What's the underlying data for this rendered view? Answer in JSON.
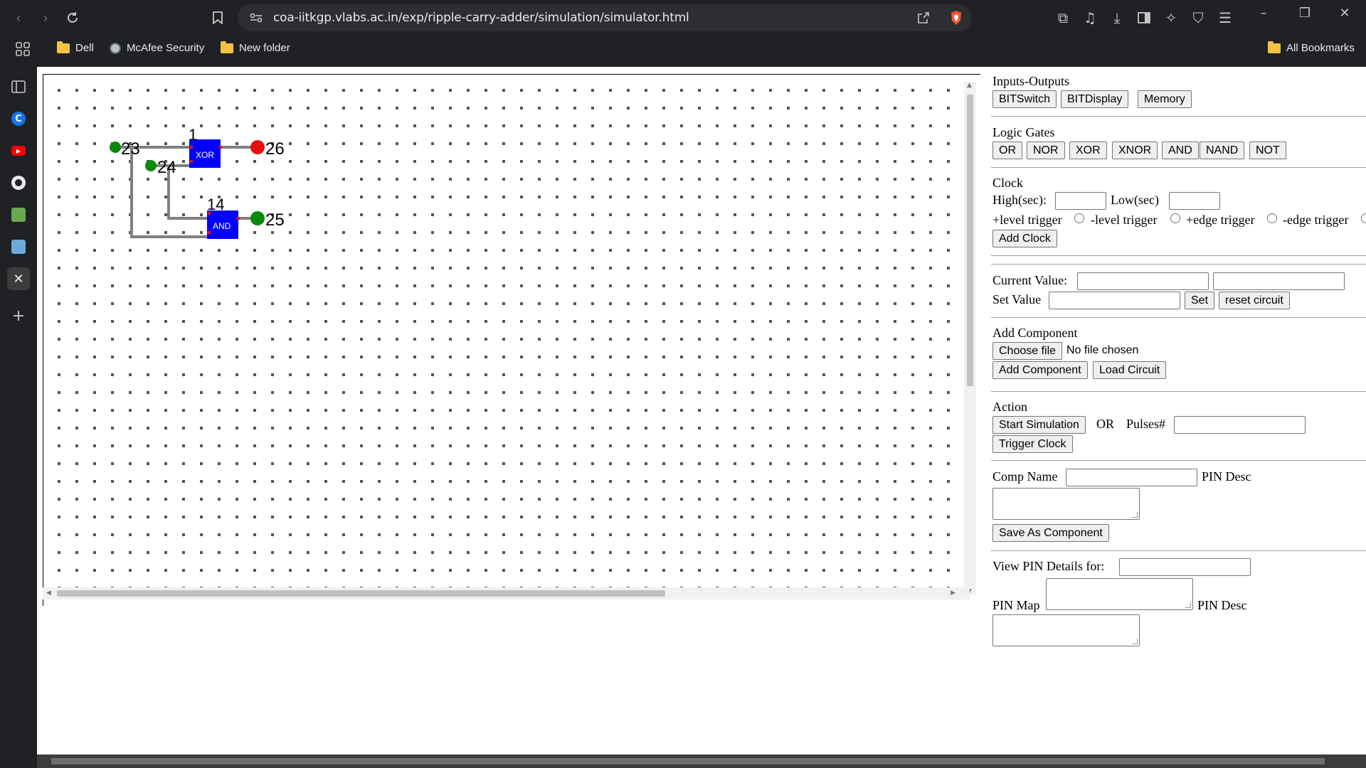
{
  "browser": {
    "url": "coa-iitkgp.vlabs.ac.in/exp/ripple-carry-adder/simulation/simulator.html",
    "bookmarks": [
      "Dell",
      "McAfee Security",
      "New folder"
    ],
    "all_bookmarks": "All Bookmarks",
    "sidebar_icons": [
      "sidebar-icon",
      "c-icon",
      "youtube-icon",
      "github-icon",
      "image-icon",
      "image-icon-2",
      "close-icon",
      "plus-icon"
    ]
  },
  "circuit": {
    "gates": [
      {
        "label": "XOR",
        "number": "1"
      },
      {
        "label": "AND",
        "number": "14"
      }
    ],
    "nodes": [
      {
        "label": "23",
        "color": "#0a8a0a"
      },
      {
        "label": "24",
        "color": "#0a8a0a"
      },
      {
        "label": "26",
        "color": "#e81010"
      },
      {
        "label": "25",
        "color": "#0a8a0a"
      }
    ],
    "wire_color": "#808080",
    "gate_color": "#0000ff"
  },
  "panel": {
    "io": {
      "title": "Inputs-Outputs",
      "buttons": [
        "BITSwitch",
        "BITDisplay",
        "Memory"
      ]
    },
    "gates": {
      "title": "Logic Gates",
      "buttons": [
        "OR",
        "NOR",
        "XOR",
        "XNOR",
        "AND",
        "NAND",
        "NOT"
      ]
    },
    "clock": {
      "title": "Clock",
      "high_label": "High(sec):",
      "low_label": "Low(sec)",
      "triggers": [
        "+level trigger",
        "-level trigger",
        "+edge trigger",
        "-edge trigger"
      ],
      "add_button": "Add Clock"
    },
    "values": {
      "current_label": "Current Value:",
      "set_label": "Set Value",
      "set_button": "Set",
      "reset_button": "reset circuit"
    },
    "component": {
      "title": "Add Component",
      "choose_button": "Choose file",
      "no_file": "No file chosen",
      "add_button": "Add Component",
      "load_button": "Load Circuit"
    },
    "action": {
      "title": "Action",
      "start_button": "Start Simulation",
      "or_label": "OR",
      "pulses_label": "Pulses#",
      "trigger_button": "Trigger Clock"
    },
    "save": {
      "comp_name_label": "Comp Name",
      "pin_desc_label": "PIN Desc",
      "save_button": "Save As Component"
    },
    "pins": {
      "view_label": "View PIN Details for:",
      "pin_map_label": "PIN Map",
      "pin_desc_label": "PIN Desc"
    }
  }
}
